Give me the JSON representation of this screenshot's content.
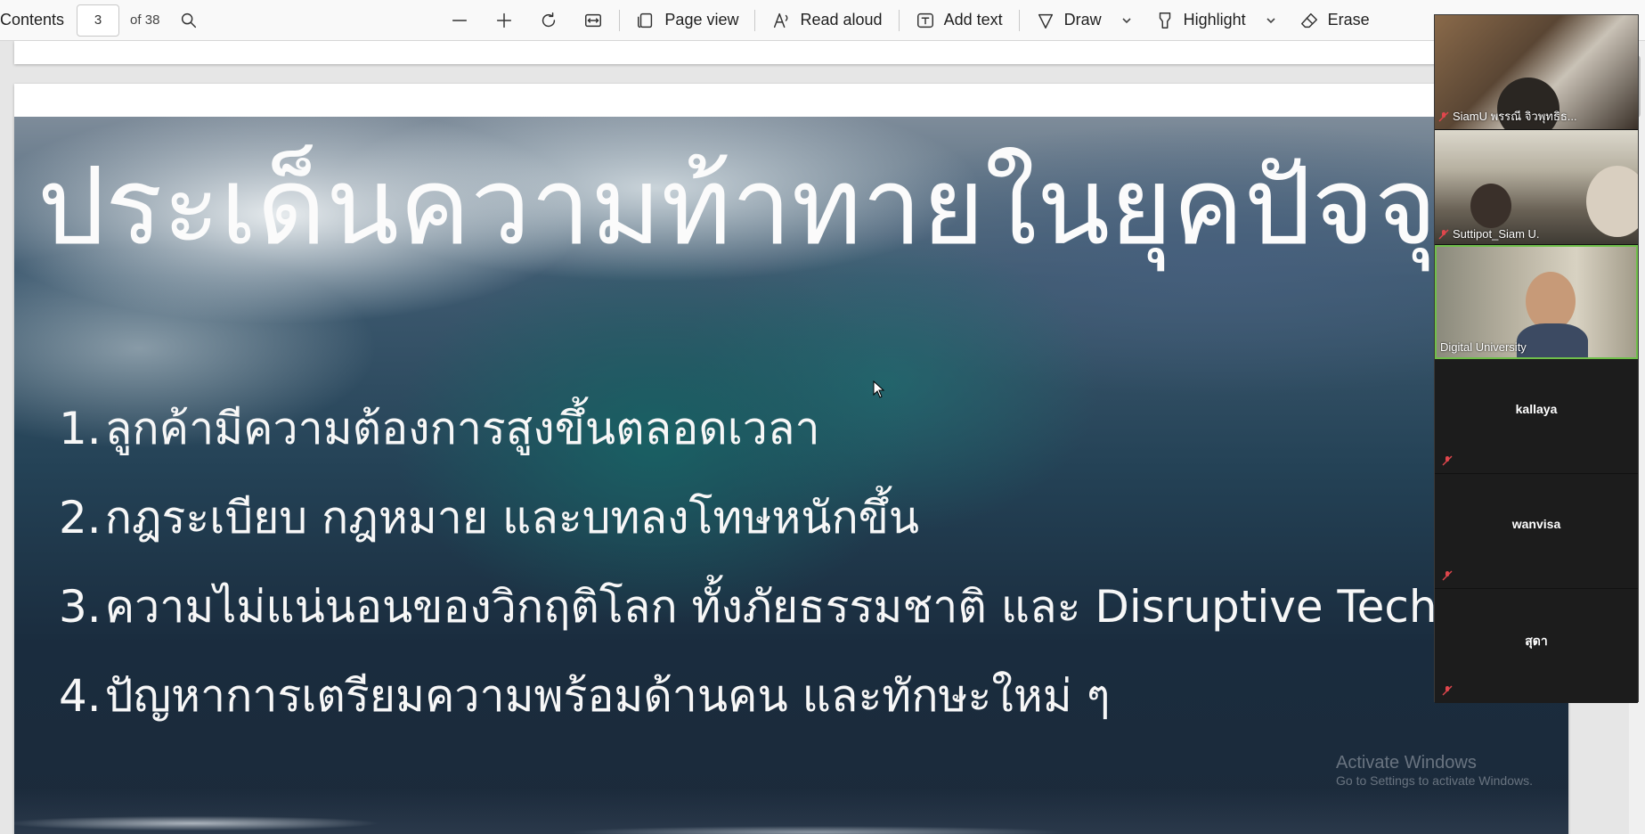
{
  "toolbar": {
    "contents_label": "Contents",
    "page_number": "3",
    "page_total": "of 38",
    "page_view_label": "Page view",
    "read_aloud_label": "Read aloud",
    "add_text_label": "Add text",
    "draw_label": "Draw",
    "highlight_label": "Highlight",
    "erase_label": "Erase"
  },
  "slide": {
    "title": "ประเด็นความท้าทายในยุคปัจจุบัน",
    "items": [
      {
        "num": "1.",
        "text": "ลูกค้ามีความต้องการสูงขึ้นตลอดเวลา"
      },
      {
        "num": "2.",
        "text": "กฎระเบียบ กฎหมาย และบทลงโทษหนักขึ้น"
      },
      {
        "num": "3.",
        "text": "ความไม่แน่นอนของวิกฤติโลก ทั้งภัยธรรมชาติ และ Disruptive Technology"
      },
      {
        "num": "4.",
        "text": "ปัญหาการเตรียมความพร้อมด้านคน และทักษะใหม่ ๆ"
      }
    ]
  },
  "watermark": {
    "line1": "Activate Windows",
    "line2": "Go to Settings to activate Windows."
  },
  "meeting": {
    "participants": [
      {
        "name": "SiamU พรรณี จิวพุทธิธ...",
        "muted": true
      },
      {
        "name": "Suttipot_Siam U.",
        "muted": true
      },
      {
        "name": "Digital University",
        "muted": false
      },
      {
        "name": "kallaya",
        "muted": true
      },
      {
        "name": "wanvisa",
        "muted": true
      },
      {
        "name": "สุดา",
        "muted": true
      }
    ],
    "active_speaker_color": "#6fbf4a",
    "muted_icon_color": "#e0464c"
  }
}
